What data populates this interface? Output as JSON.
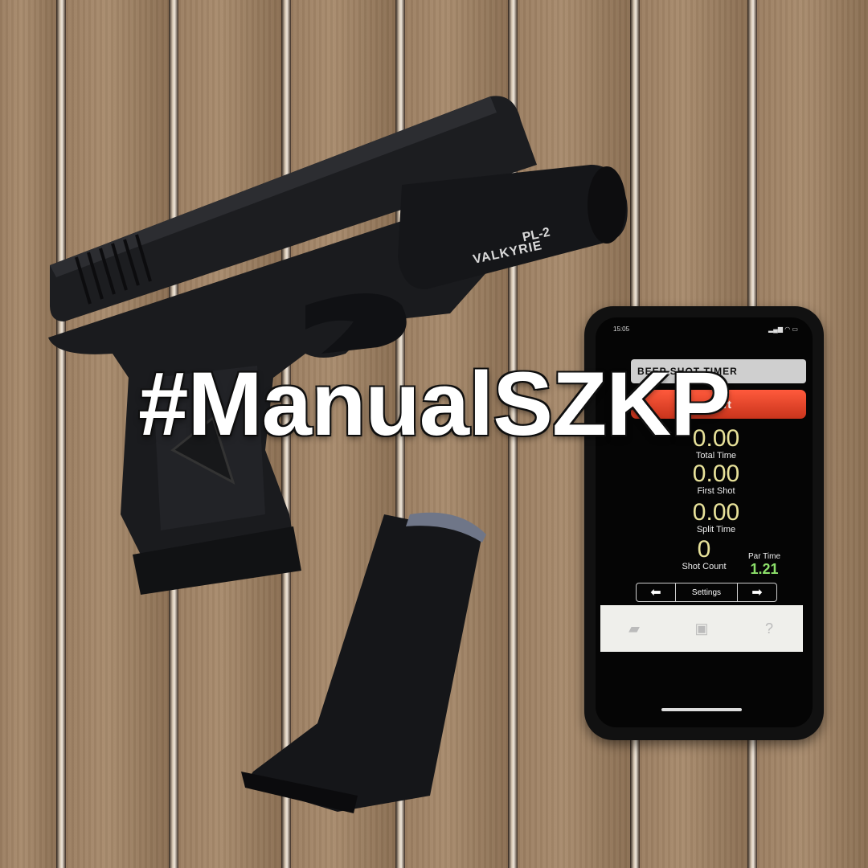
{
  "overlay": {
    "hashtag": "#ManualSZKP"
  },
  "flashlight": {
    "model": "PL-2",
    "brand": "VALKYRIE"
  },
  "phone": {
    "status_time": "15:05",
    "app_header": "BEEP SHOT TIMER",
    "start_label": "Start",
    "total_time": {
      "value": "0.00",
      "label": "Total Time"
    },
    "first_shot": {
      "value": "0.00",
      "label": "First Shot"
    },
    "split_time": {
      "value": "0.00",
      "label": "Split Time"
    },
    "shot_count": {
      "value": "0",
      "label": "Shot Count"
    },
    "par_time": {
      "value": "1.21",
      "label": "Par Time"
    },
    "settings_label": "Settings",
    "icons": {
      "prev": "arrow-left-icon",
      "next": "arrow-right-icon",
      "tab1": "pistol-icon",
      "tab2": "book-icon",
      "tab3": "help-icon"
    }
  },
  "colors": {
    "wood": "#9b7e61",
    "start": "#e8452a",
    "readout": "#e8e29a",
    "par": "#8ce06a"
  }
}
